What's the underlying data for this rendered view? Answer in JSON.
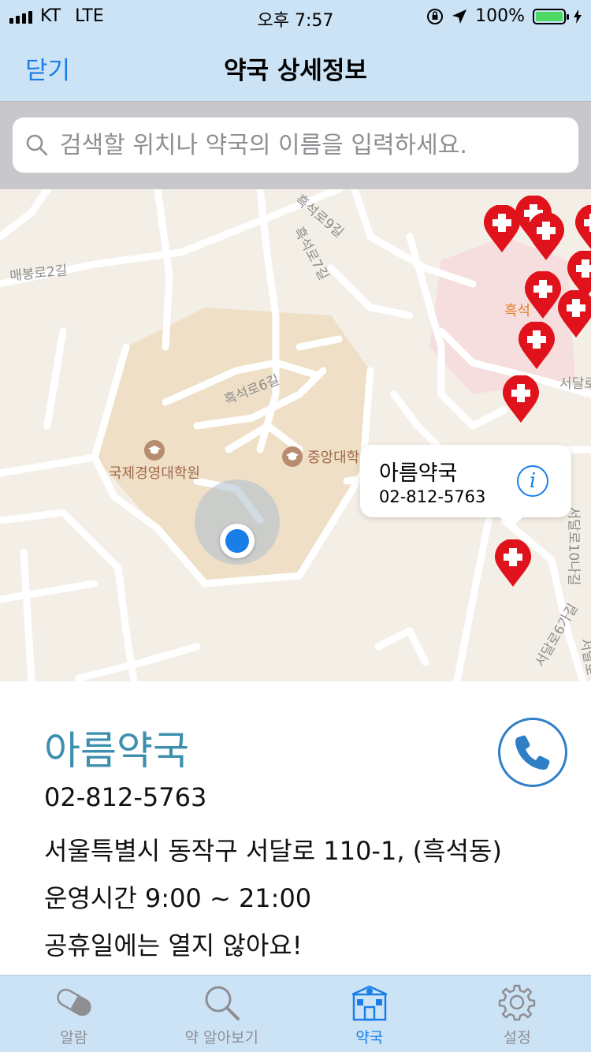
{
  "status_bar": {
    "carrier": "KT",
    "network": "LTE",
    "time": "오후 7:57",
    "battery": "100%",
    "battery_level": 1.0
  },
  "nav": {
    "close_label": "닫기",
    "title": "약국 상세정보"
  },
  "search": {
    "placeholder": "검색할 위치나 약국의 이름을 입력하세요."
  },
  "map": {
    "road_labels": [
      "매봉로2길",
      "흑석로9길",
      "흑석로7길",
      "흑석로6길",
      "서달로",
      "서달로10나길",
      "서달로6가길",
      "서달로",
      "흑석"
    ],
    "pois": [
      "국제경영대학원",
      "중앙대학"
    ],
    "callout": {
      "name": "아름약국",
      "phone": "02-812-5763",
      "info_symbol": "i"
    },
    "pin_color": "#e0121b"
  },
  "pharmacy": {
    "name": "아름약국",
    "phone": "02-812-5763",
    "address": "서울특별시 동작구 서달로 110-1, (흑석동)",
    "hours": "운영시간 9:00 ~ 21:00",
    "holiday_note": "공휴일에는 열지 않아요!"
  },
  "tabs": [
    {
      "label": "알람",
      "icon": "pill-icon",
      "active": false
    },
    {
      "label": "약 알아보기",
      "icon": "search-icon",
      "active": false
    },
    {
      "label": "약국",
      "icon": "pharmacy-icon",
      "active": true
    },
    {
      "label": "설정",
      "icon": "gear-icon",
      "active": false
    }
  ],
  "colors": {
    "accent": "#1a7ee8",
    "bar_bg": "#cce3f6",
    "name_color": "#3d8fae"
  }
}
